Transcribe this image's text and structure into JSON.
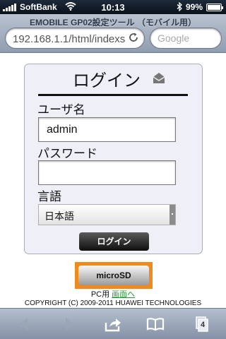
{
  "status_bar": {
    "carrier": "SoftBank",
    "time": "10:13",
    "battery": "99%"
  },
  "browser": {
    "page_title": "EMOBILE GP02設定ツール （モバイル用）",
    "url": "192.168.1.1/html/indexs",
    "search_placeholder": "Google"
  },
  "login": {
    "title": "ログイン",
    "username_label": "ユーザ名",
    "username_value": "admin",
    "password_label": "パスワード",
    "password_value": "",
    "language_label": "言語",
    "language_value": "日本語",
    "login_button": "ログイン"
  },
  "footer": {
    "microsd_button": "microSD",
    "pc_prefix": "PC用",
    "pc_link": "画面へ",
    "copyright": "COPYRIGHT (C) 2009-2011 HUAWEI TECHNOLOGIES"
  },
  "toolbar": {
    "pages_count": "4"
  },
  "colors": {
    "highlight": "#f08a1c",
    "link": "#2a9a3a"
  }
}
